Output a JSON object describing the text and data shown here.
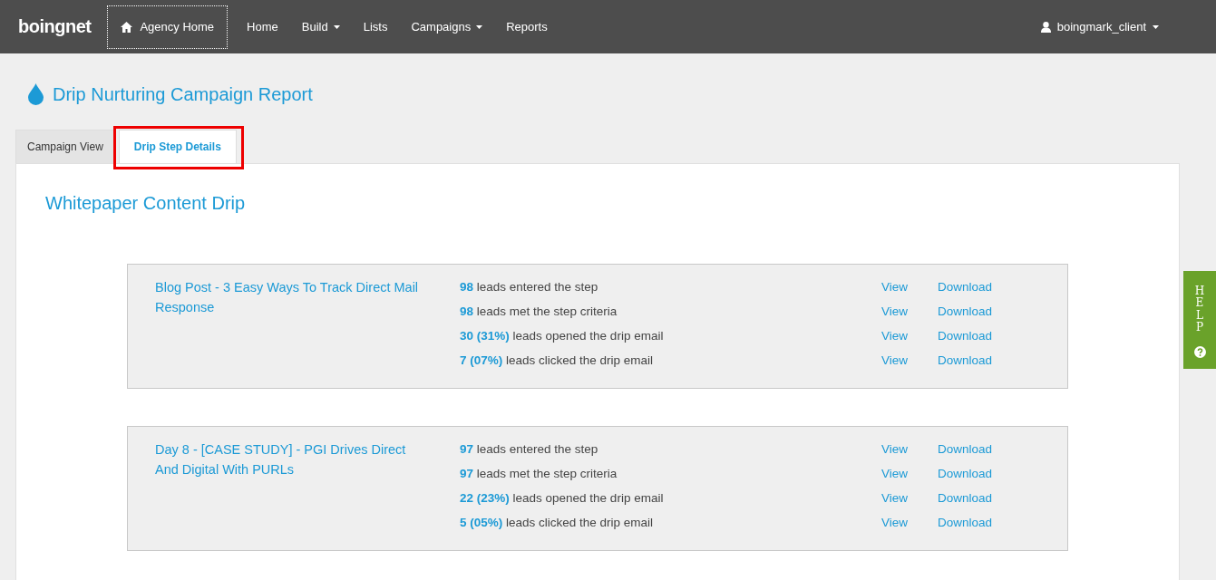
{
  "navbar": {
    "logo": "boingnet",
    "agency_home": "Agency Home",
    "items": [
      {
        "label": "Home",
        "dropdown": false
      },
      {
        "label": "Build",
        "dropdown": true
      },
      {
        "label": "Lists",
        "dropdown": false
      },
      {
        "label": "Campaigns",
        "dropdown": true
      },
      {
        "label": "Reports",
        "dropdown": false
      }
    ],
    "user": "boingmark_client"
  },
  "page_title": "Drip Nurturing Campaign Report",
  "tabs": [
    {
      "label": "Campaign View",
      "selected": false,
      "highlighted": false
    },
    {
      "label": "Drip Step Details",
      "selected": true,
      "highlighted": true
    }
  ],
  "campaign_title": "Whitepaper Content Drip",
  "steps": [
    {
      "title": "Blog Post - 3 Easy Ways To Track Direct Mail Response",
      "stats": [
        {
          "value": "98",
          "text": "leads entered the step",
          "view": "View",
          "download": "Download"
        },
        {
          "value": "98",
          "text": "leads met the step criteria",
          "view": "View",
          "download": "Download"
        },
        {
          "value": "30 (31%)",
          "text": "leads opened the drip email",
          "view": "View",
          "download": "Download"
        },
        {
          "value": "7 (07%)",
          "text": "leads clicked the drip email",
          "view": "View",
          "download": "Download"
        }
      ]
    },
    {
      "title": "Day 8 - [CASE STUDY] - PGI Drives Direct And Digital With PURLs",
      "stats": [
        {
          "value": "97",
          "text": "leads entered the step",
          "view": "View",
          "download": "Download"
        },
        {
          "value": "97",
          "text": "leads met the step criteria",
          "view": "View",
          "download": "Download"
        },
        {
          "value": "22 (23%)",
          "text": "leads opened the drip email",
          "view": "View",
          "download": "Download"
        },
        {
          "value": "5 (05%)",
          "text": "leads clicked the drip email",
          "view": "View",
          "download": "Download"
        }
      ]
    }
  ],
  "help": "HELP"
}
